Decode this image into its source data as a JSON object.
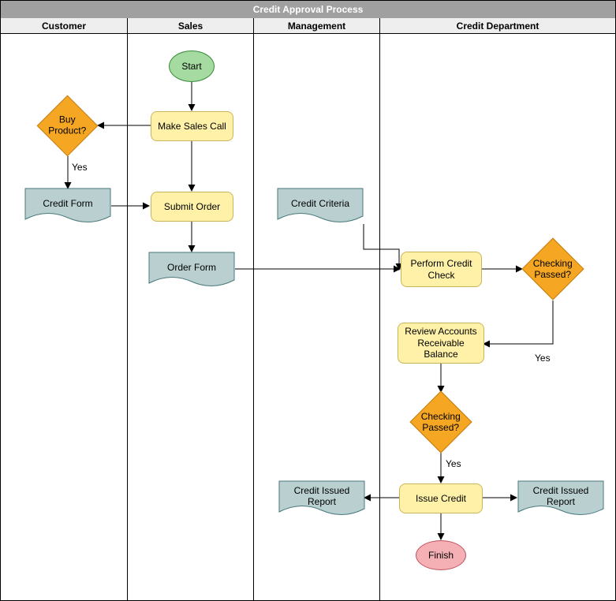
{
  "title": "Credit Approval Process",
  "lanes": {
    "customer": "Customer",
    "sales": "Sales",
    "management": "Management",
    "credit": "Credit Department"
  },
  "nodes": {
    "start": "Start",
    "makeSalesCall": "Make Sales Call",
    "buyProduct": "Buy Product?",
    "buyProductYes": "Yes",
    "creditForm": "Credit Form",
    "submitOrder": "Submit Order",
    "orderForm": "Order Form",
    "creditCriteria": "Credit Criteria",
    "performCreditCheck": "Perform Credit Check",
    "checkingPassed1": "Checking Passed?",
    "checkingPassed1Yes": "Yes",
    "reviewAR": "Review Accounts Receivable Balance",
    "checkingPassed2": "Checking Passed?",
    "checkingPassed2Yes": "Yes",
    "issueCredit": "Issue Credit",
    "creditIssuedReportL": "Credit Issued Report",
    "creditIssuedReportR": "Credit Issued Report",
    "finish": "Finish"
  },
  "chart_data": {
    "type": "swimlane-flowchart",
    "title": "Credit Approval Process",
    "lanes": [
      "Customer",
      "Sales",
      "Management",
      "Credit Department"
    ],
    "nodes": [
      {
        "id": "start",
        "lane": "Sales",
        "type": "start",
        "label": "Start"
      },
      {
        "id": "makeSalesCall",
        "lane": "Sales",
        "type": "process",
        "label": "Make Sales Call"
      },
      {
        "id": "buyProduct",
        "lane": "Customer",
        "type": "decision",
        "label": "Buy Product?"
      },
      {
        "id": "creditForm",
        "lane": "Customer",
        "type": "document",
        "label": "Credit Form"
      },
      {
        "id": "submitOrder",
        "lane": "Sales",
        "type": "process",
        "label": "Submit Order"
      },
      {
        "id": "orderForm",
        "lane": "Sales",
        "type": "document",
        "label": "Order Form"
      },
      {
        "id": "creditCriteria",
        "lane": "Management",
        "type": "document",
        "label": "Credit Criteria"
      },
      {
        "id": "performCreditCheck",
        "lane": "Credit Department",
        "type": "process",
        "label": "Perform Credit Check"
      },
      {
        "id": "checkingPassed1",
        "lane": "Credit Department",
        "type": "decision",
        "label": "Checking Passed?"
      },
      {
        "id": "reviewAR",
        "lane": "Credit Department",
        "type": "process",
        "label": "Review Accounts Receivable Balance"
      },
      {
        "id": "checkingPassed2",
        "lane": "Credit Department",
        "type": "decision",
        "label": "Checking Passed?"
      },
      {
        "id": "issueCredit",
        "lane": "Credit Department",
        "type": "process",
        "label": "Issue Credit"
      },
      {
        "id": "creditIssuedReportL",
        "lane": "Management",
        "type": "document",
        "label": "Credit Issued Report"
      },
      {
        "id": "creditIssuedReportR",
        "lane": "Credit Department",
        "type": "document",
        "label": "Credit Issued Report"
      },
      {
        "id": "finish",
        "lane": "Credit Department",
        "type": "end",
        "label": "Finish"
      }
    ],
    "edges": [
      {
        "from": "start",
        "to": "makeSalesCall"
      },
      {
        "from": "makeSalesCall",
        "to": "buyProduct"
      },
      {
        "from": "buyProduct",
        "to": "creditForm",
        "label": "Yes"
      },
      {
        "from": "creditForm",
        "to": "submitOrder"
      },
      {
        "from": "makeSalesCall",
        "to": "submitOrder"
      },
      {
        "from": "submitOrder",
        "to": "orderForm"
      },
      {
        "from": "orderForm",
        "to": "performCreditCheck"
      },
      {
        "from": "creditCriteria",
        "to": "performCreditCheck"
      },
      {
        "from": "performCreditCheck",
        "to": "checkingPassed1"
      },
      {
        "from": "checkingPassed1",
        "to": "reviewAR",
        "label": "Yes"
      },
      {
        "from": "reviewAR",
        "to": "checkingPassed2"
      },
      {
        "from": "checkingPassed2",
        "to": "issueCredit",
        "label": "Yes"
      },
      {
        "from": "issueCredit",
        "to": "creditIssuedReportL"
      },
      {
        "from": "issueCredit",
        "to": "creditIssuedReportR"
      },
      {
        "from": "issueCredit",
        "to": "finish"
      }
    ]
  }
}
